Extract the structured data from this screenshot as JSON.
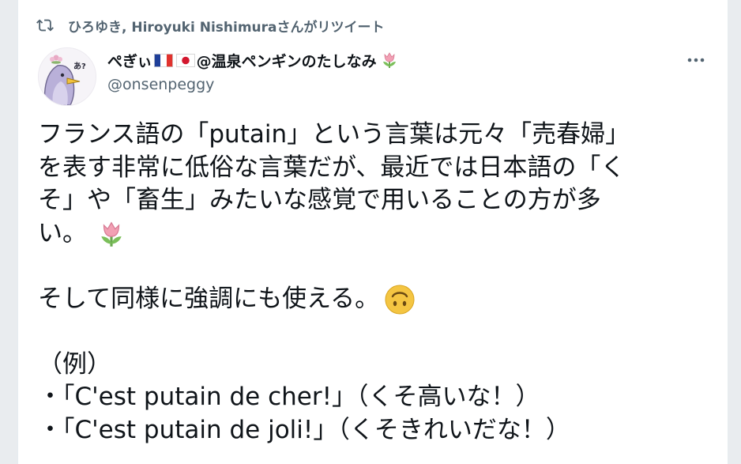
{
  "retweet": {
    "icon": "retweet-icon",
    "text": "ひろゆき, Hiroyuki Nishimuraさんがリツイート"
  },
  "author": {
    "name_prefix": "ぺぎぃ",
    "flags": [
      "flag-france-icon",
      "flag-japan-icon"
    ],
    "name_suffix": "@温泉ペンギンのたしなみ",
    "name_emoji": "tulip-icon",
    "handle": "@onsenpeggy",
    "avatar": "penguin-avatar",
    "avatar_text": "あ?"
  },
  "menu": {
    "icon": "more-options-icon"
  },
  "tweet": {
    "lines": [
      "フランス語の「putain」という言葉は元々「売春婦」",
      "を表す非常に低俗な言葉だが、最近では日本語の「く",
      "そ」や「畜生」みたいな感覚で用いることの方が多",
      "い。"
    ],
    "line2": "そして同様に強調にも使える。",
    "example_heading": "（例）",
    "examples": [
      "・「C'est putain de cher!」（くそ高いな！）",
      "・「C'est putain de joli!」（くそきれいだな！）"
    ],
    "emoji_1": "tulip-icon",
    "emoji_2": "upside-down-face-icon"
  },
  "colors": {
    "text_primary": "#0f1419",
    "text_secondary": "#536471",
    "background": "#ffffff"
  }
}
